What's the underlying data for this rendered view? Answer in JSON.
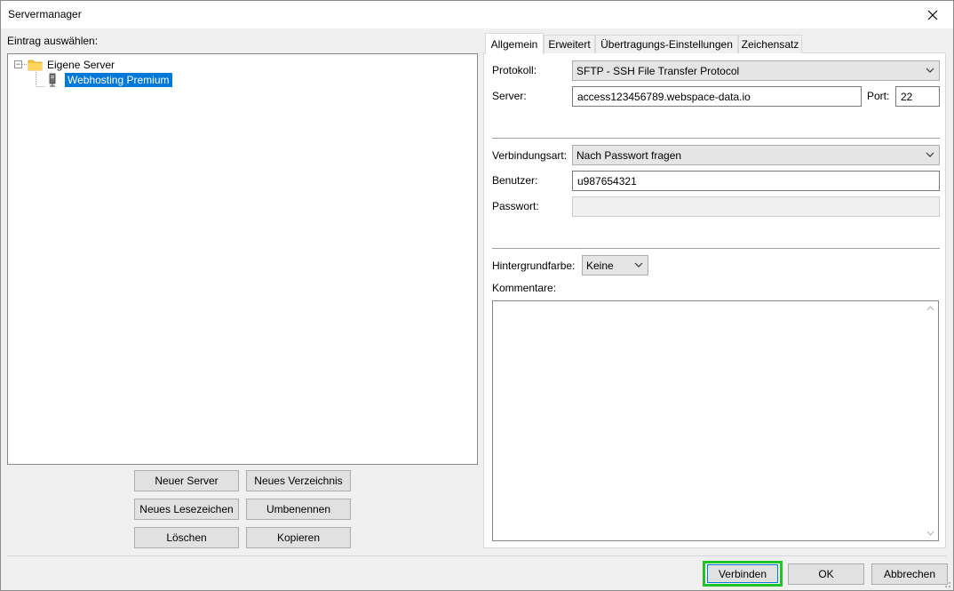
{
  "window": {
    "title": "Servermanager"
  },
  "left": {
    "select_label": "Eintrag auswählen:",
    "tree": {
      "root_label": "Eigene Server",
      "child_label": "Webhosting Premium"
    },
    "buttons": {
      "new_server": "Neuer Server",
      "new_folder": "Neues Verzeichnis",
      "new_bookmark": "Neues Lesezeichen",
      "rename": "Umbenennen",
      "delete": "Löschen",
      "copy": "Kopieren"
    }
  },
  "tabs": [
    "Allgemein",
    "Erweitert",
    "Übertragungs-Einstellungen",
    "Zeichensatz"
  ],
  "general": {
    "protocol_label": "Protokoll:",
    "protocol_value": "SFTP - SSH File Transfer Protocol",
    "server_label": "Server:",
    "server_value": "access123456789.webspace-data.io",
    "port_label": "Port:",
    "port_value": "22",
    "logon_label": "Verbindungsart:",
    "logon_value": "Nach Passwort fragen",
    "user_label": "Benutzer:",
    "user_value": "u987654321",
    "password_label": "Passwort:",
    "bgcolor_label": "Hintergrundfarbe:",
    "bgcolor_value": "Keine",
    "comments_label": "Kommentare:"
  },
  "footer": {
    "connect": "Verbinden",
    "ok": "OK",
    "cancel": "Abbrechen"
  },
  "colors": {
    "selection": "#0078d7",
    "highlight_border": "#22c22a",
    "folder": "#f4c63d"
  }
}
